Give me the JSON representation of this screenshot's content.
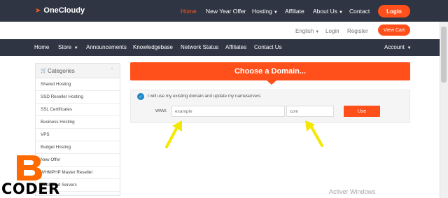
{
  "brand": {
    "name": "OneCloudy",
    "icon": "rocket-icon",
    "accent": "#ff4f1a",
    "nav_bg": "#2f3542"
  },
  "topnav": {
    "home": "Home",
    "new_year_offer": "New Year Offer",
    "hosting": "Hosting",
    "affiliate": "Affiliate",
    "about_us": "About Us",
    "contact": "Contact",
    "login": "Login"
  },
  "secondary": {
    "language": "English",
    "login": "Login",
    "register": "Register",
    "view_cart": "View Cart"
  },
  "mainnav": {
    "home": "Home",
    "store": "Store",
    "announcements": "Announcements",
    "knowledgebase": "Knowledgebase",
    "network_status": "Network Status",
    "affiliates": "Affiliates",
    "contact_us": "Contact Us",
    "account": "Account"
  },
  "sidebar": {
    "title": "Categories",
    "items": [
      {
        "label": "Shared Hosting"
      },
      {
        "label": "SSD Reseller Hosting"
      },
      {
        "label": "SSL Certificates"
      },
      {
        "label": "Business Hosting"
      },
      {
        "label": "VPS"
      },
      {
        "label": "Budget Hosting"
      },
      {
        "label": "New Offer"
      },
      {
        "label": "WHMPHP Master Reseller"
      },
      {
        "label": "Dedicated Servers"
      }
    ]
  },
  "domain": {
    "heading": "Choose a Domain...",
    "option_label": "I will use my existing domain and update my nameservers",
    "prefix": "www.",
    "sld_placeholder": "example",
    "tld_placeholder": "com",
    "use_button": "Use"
  },
  "overlay": {
    "activate_text": "Activer Windows",
    "watermark_letter": "B",
    "watermark_text": "CODER",
    "arrow_color": "#f5e800"
  }
}
